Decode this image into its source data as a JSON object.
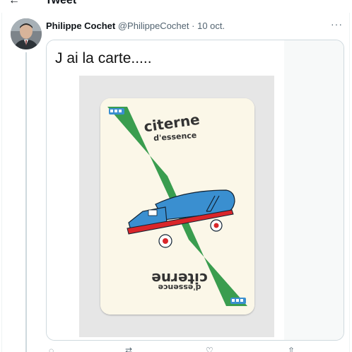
{
  "top_bar": {
    "title": "Tweet",
    "back_icon": "arrow-left-icon"
  },
  "tweet": {
    "author_name": "Philippe Cochet",
    "handle": "@PhilippeCochet",
    "separator": "·",
    "date": "10 oct.",
    "more_label": "···",
    "avatar_icon": "avatar",
    "quote": {
      "text": "J ai la carte.....",
      "card": {
        "label_top_line1": "citerne",
        "label_top_line2": "d'essence",
        "label_bottom_line1": "citerne",
        "label_bottom_line2": "d'essence",
        "colors": {
          "stripe": "#3a9d4f",
          "truck_tank": "#3a8fd0",
          "truck_chassis": "#d9262a"
        }
      }
    },
    "actions": [
      "reply-icon",
      "retweet-icon",
      "like-icon",
      "share-icon"
    ]
  },
  "colors": {
    "accent": "#1d9bf0",
    "border": "#cfd9de",
    "muted": "#536471"
  }
}
